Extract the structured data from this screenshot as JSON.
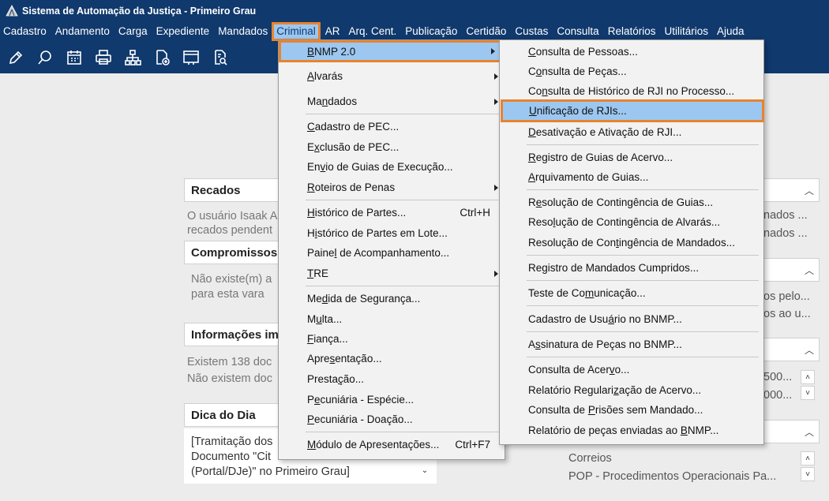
{
  "window": {
    "title": "Sistema de Automação da Justiça - Primeiro Grau"
  },
  "menubar": [
    "Cadastro",
    "Andamento",
    "Carga",
    "Expediente",
    "Mandados",
    "Criminal",
    "AR",
    "Arq. Cent.",
    "Publicação",
    "Certidão",
    "Custas",
    "Consulta",
    "Relatórios",
    "Utilitários",
    "Ajuda"
  ],
  "menubar_active": "Criminal",
  "toolbar_icons": [
    "edit-icon",
    "search-icon",
    "calendar-icon",
    "printer-icon",
    "org-chart-icon",
    "document-add-icon",
    "window-icon",
    "document-search-icon"
  ],
  "panels": {
    "recados": {
      "title": "Recados",
      "line1": "O usuário Isaak A",
      "line2": "recados pendent"
    },
    "compromissos": {
      "title": "Compromissos",
      "line1": "Não existe(m) a",
      "line2": "para esta vara"
    },
    "informacoes": {
      "title": "Informações im",
      "line1": "Existem 138 doc",
      "line2": "Não existem doc"
    },
    "dica": {
      "title": "Dica do Dia",
      "line1": "[Tramitação dos",
      "line2": "Documento \"Cit",
      "line3": "(Portal/DJe)\" no Primeiro Grau]"
    }
  },
  "right_panels": {
    "r1a": "nados ...",
    "r1b": "nados ...",
    "r2a": "os pelo...",
    "r2b": "os ao u...",
    "r3a": "500...",
    "r3b": "000...",
    "r4a": "Correios",
    "r4b": "POP - Procedimentos Operacionais Pa..."
  },
  "criminal_menu": {
    "items": [
      {
        "label": "BNMP 2.0",
        "u": "B",
        "submenu": true
      },
      {
        "label": "Alvarás",
        "u": "A",
        "submenu": true
      },
      {
        "label": "Mandados",
        "u": "n",
        "submenu": true
      },
      {
        "label": "Cadastro de PEC...",
        "u": "C"
      },
      {
        "label": "Exclusão de PEC...",
        "u": "x"
      },
      {
        "label": "Envio de Guias de Execução...",
        "u": "v"
      },
      {
        "label": "Roteiros de Penas",
        "u": "R",
        "submenu": true
      },
      {
        "label": "Histórico de Partes...",
        "u": "H",
        "shortcut": "Ctrl+H"
      },
      {
        "label": "Histórico de Partes em Lote...",
        "u": "i"
      },
      {
        "label": "Painel de Acompanhamento...",
        "u": "l"
      },
      {
        "label": "TRE",
        "u": "T",
        "submenu": true
      },
      {
        "label": "Medida de Segurança...",
        "u": "d"
      },
      {
        "label": "Multa...",
        "u": "u"
      },
      {
        "label": "Fiança...",
        "u": "F"
      },
      {
        "label": "Apresentação...",
        "u": "s"
      },
      {
        "label": "Prestação...",
        "u": "ç"
      },
      {
        "label": "Pecuniária - Espécie...",
        "u": "e"
      },
      {
        "label": "Pecuniária - Doação...",
        "u": "P"
      },
      {
        "label": "Módulo de Apresentações...",
        "u": "M",
        "shortcut": "Ctrl+F7"
      }
    ]
  },
  "bnmp_submenu": {
    "items": [
      {
        "label": "Consulta de Pessoas...",
        "u": "C"
      },
      {
        "label": "Consulta de Peças...",
        "u": "o"
      },
      {
        "label": "Consulta de Histórico de RJI no Processo...",
        "u": "n"
      },
      {
        "label": "Unificação de RJIs...",
        "u": "U",
        "highlight": true
      },
      {
        "label": "Desativação e Ativação de RJI...",
        "u": "D"
      },
      {
        "label": "Registro de Guias de Acervo...",
        "u": "R"
      },
      {
        "label": "Arquivamento de Guias...",
        "u": "A"
      },
      {
        "label": "Resolução de Contingência de Guias...",
        "u": "e"
      },
      {
        "label": "Resolução de Contingência de Alvarás...",
        "u": "l"
      },
      {
        "label": "Resolução de Contingência de Mandados...",
        "u": "t"
      },
      {
        "label": "Registro de Mandados Cumpridos...",
        "u": ""
      },
      {
        "label": "Teste de Comunicação...",
        "u": "m"
      },
      {
        "label": "Cadastro de Usuário no BNMP...",
        "u": "á"
      },
      {
        "label": "Assinatura de Peças no BNMP...",
        "u": "s"
      },
      {
        "label": "Consulta de Acervo...",
        "u": "v"
      },
      {
        "label": "Relatório Regularização de Acervo...",
        "u": "z"
      },
      {
        "label": "Consulta de Prisões sem Mandado...",
        "u": "P"
      },
      {
        "label": "Relatório de peças enviadas ao BNMP...",
        "u": "B"
      }
    ]
  }
}
